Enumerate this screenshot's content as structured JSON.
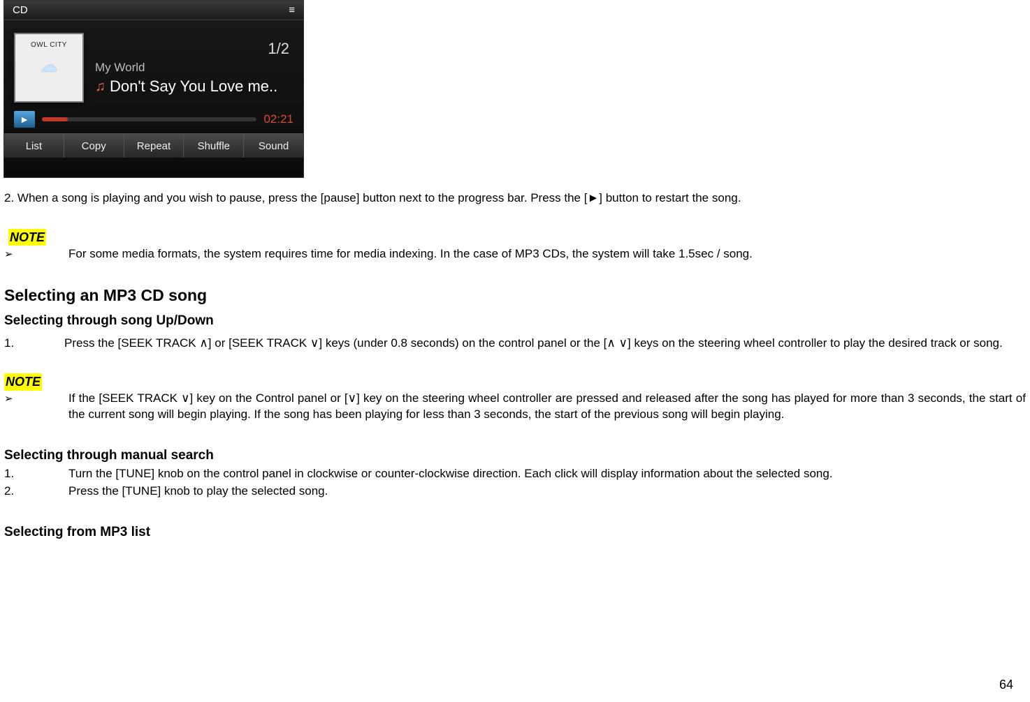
{
  "player": {
    "header_left": "CD",
    "header_right": "≡",
    "album_art_label1": "OWL CITY",
    "album_label": "My World",
    "track_title": "Don't Say You Love me..",
    "page_indicator": "1/2",
    "time": "02:21",
    "buttons": [
      "List",
      "Copy",
      "Repeat",
      "Shuffle",
      "Sound"
    ]
  },
  "doc": {
    "para1": "2. When a song is playing and you wish to pause, press the [pause] button next to the progress bar. Press the [►] button to restart the song.",
    "note_label": "NOTE",
    "note1_body": "For some media formats, the system requires time for media indexing. In the case of MP3 CDs, the system will take 1.5sec / song.",
    "h2_1": "Selecting an MP3 CD song",
    "h3_1": "Selecting through song Up/Down",
    "ol1_num": "1.",
    "ol1_body": "Press the [SEEK TRACK ∧] or [SEEK TRACK ∨] keys (under 0.8 seconds) on the control panel or the [∧ ∨] keys on the steering wheel controller to play the desired track or song.",
    "note2_body": "If the [SEEK TRACK ∨] key on the Control panel or [∨] key on the steering wheel controller are pressed and released after the song has played for more than 3 seconds, the start of the current song will begin playing. If the song has been playing for less than 3 seconds, the start of the previous song will begin playing.",
    "h3_2": "Selecting through manual search",
    "ol2a_num": "1.",
    "ol2a_body": "Turn the [TUNE] knob on the control panel in clockwise or counter-clockwise direction. Each click will display information about the selected song.",
    "ol2b_num": "2.",
    "ol2b_body": "Press the [TUNE] knob to play the selected song.",
    "h3_3": "Selecting from MP3 list",
    "page_number": "64"
  }
}
